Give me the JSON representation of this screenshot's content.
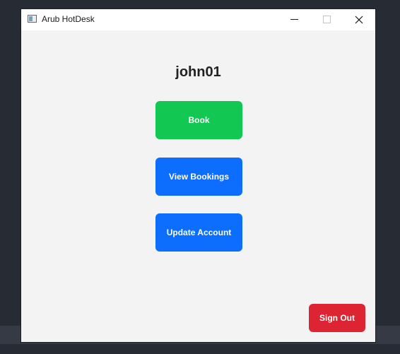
{
  "window": {
    "title": "Arub HotDesk",
    "icon": "app-window-icon"
  },
  "main": {
    "username": "john01",
    "book_label": "Book",
    "view_bookings_label": "View Bookings",
    "update_account_label": "Update Account",
    "sign_out_label": "Sign Out"
  },
  "colors": {
    "book": "#12c853",
    "primary": "#0d6efd",
    "danger": "#dc2433",
    "background": "#f3f3f3"
  }
}
